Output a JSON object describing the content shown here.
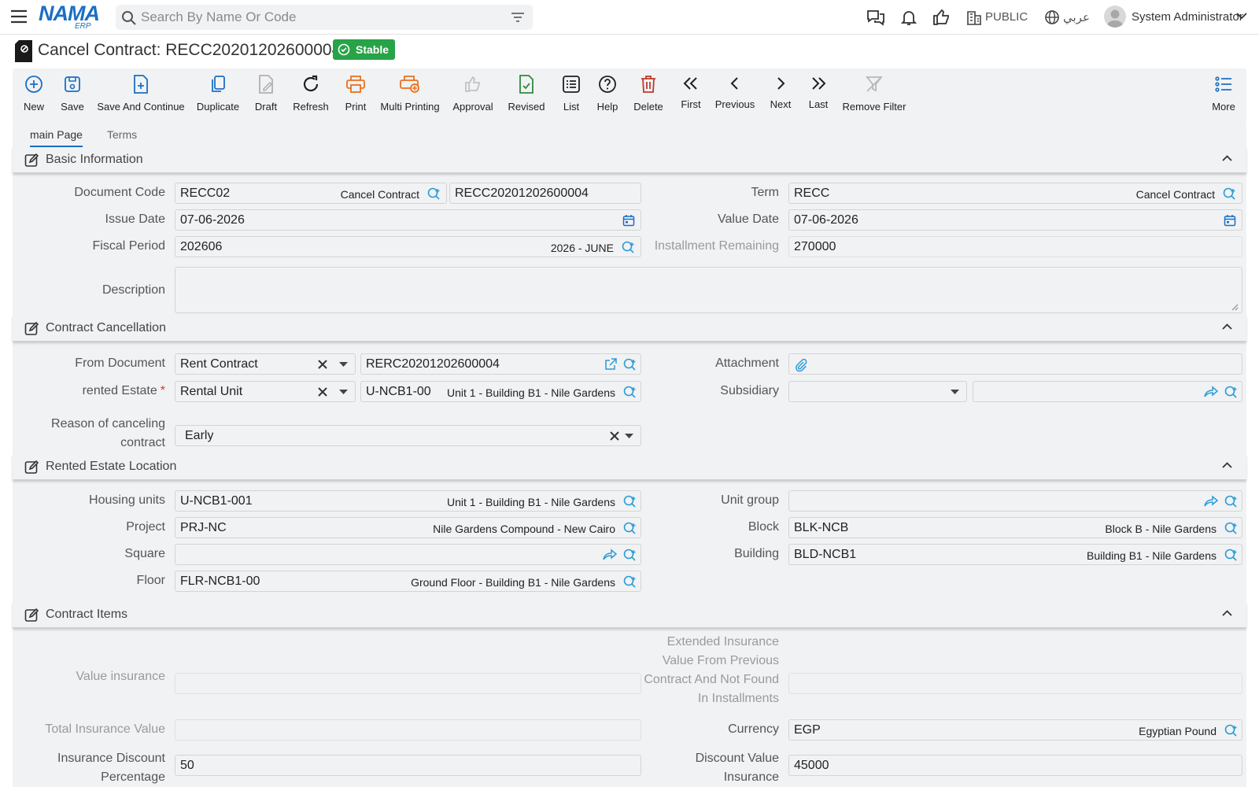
{
  "header": {
    "logo_main": "NAMA",
    "logo_sub": "ERP",
    "search_placeholder": "Search By Name Or Code",
    "branch": "PUBLIC",
    "language": "عربي",
    "user": "System Administrator"
  },
  "page": {
    "title": "Cancel Contract: RECC20201202600004",
    "status": "Stable"
  },
  "toolbar": {
    "new": "New",
    "save": "Save",
    "save_continue": "Save And Continue",
    "duplicate": "Duplicate",
    "draft": "Draft",
    "refresh": "Refresh",
    "print": "Print",
    "multi_printing": "Multi Printing",
    "approval": "Approval",
    "revised": "Revised",
    "list": "List",
    "help": "Help",
    "delete": "Delete",
    "first": "First",
    "previous": "Previous",
    "next": "Next",
    "last": "Last",
    "remove_filter": "Remove Filter",
    "more": "More"
  },
  "tabs": [
    "main Page",
    "Terms"
  ],
  "sections": {
    "basic": "Basic Information",
    "cancellation": "Contract Cancellation",
    "location": "Rented Estate Location",
    "items": "Contract Items"
  },
  "basic": {
    "document_code_label": "Document Code",
    "document_code": "RECC02",
    "document_code_desc": "Cancel Contract",
    "document_number": "RECC20201202600004",
    "term_label": "Term",
    "term": "RECC",
    "term_desc": "Cancel Contract",
    "issue_date_label": "Issue Date",
    "issue_date": "07-06-2026",
    "value_date_label": "Value Date",
    "value_date": "07-06-2026",
    "fiscal_period_label": "Fiscal Period",
    "fiscal_period": "202606",
    "fiscal_period_desc": "2026 - JUNE",
    "installment_remaining_label": "Installment Remaining",
    "installment_remaining": "270000",
    "description_label": "Description",
    "description": ""
  },
  "cancellation": {
    "from_document_label": "From Document",
    "from_document_type": "Rent Contract",
    "from_document_code": "RERC20201202600004",
    "attachment_label": "Attachment",
    "rented_estate_label": "rented Estate",
    "rented_estate_required": "*",
    "rented_estate_type": "Rental Unit",
    "rented_estate_code": "U-NCB1-00",
    "rented_estate_desc": "Unit 1 - Building B1 - Nile Gardens",
    "subsidiary_label": "Subsidiary",
    "subsidiary": "",
    "reason_label_1": "Reason of canceling",
    "reason_label_2": "contract",
    "reason": "Early"
  },
  "location": {
    "housing_units_label": "Housing units",
    "housing_units": "U-NCB1-001",
    "housing_units_desc": "Unit 1 - Building B1 - Nile Gardens",
    "unit_group_label": "Unit group",
    "unit_group": "",
    "project_label": "Project",
    "project": "PRJ-NC",
    "project_desc": "Nile Gardens Compound - New Cairo",
    "block_label": "Block",
    "block": "BLK-NCB",
    "block_desc": "Block B - Nile Gardens",
    "square_label": "Square",
    "square": "",
    "building_label": "Building",
    "building": "BLD-NCB1",
    "building_desc": "Building B1 - Nile Gardens",
    "floor_label": "Floor",
    "floor": "FLR-NCB1-00",
    "floor_desc": "Ground Floor - Building B1 - Nile Gardens"
  },
  "items": {
    "value_insurance_label": "Value insurance",
    "value_insurance": "",
    "extended_label_1": "Extended Insurance",
    "extended_label_2": "Value From Previous",
    "extended_label_3": "Contract And Not Found",
    "extended_label_4": "In Installments",
    "extended_value": "",
    "total_insurance_label": "Total Insurance Value",
    "total_insurance": "",
    "currency_label": "Currency",
    "currency": "EGP",
    "currency_desc": "Egyptian Pound",
    "insurance_discount_label_1": "Insurance Discount",
    "insurance_discount_label_2": "Percentage",
    "insurance_discount": "50",
    "discount_value_label_1": "Discount Value",
    "discount_value_label_2": "Insurance",
    "discount_value": "45000"
  },
  "colors": {
    "accent": "#1b6fc4",
    "stable": "#27a348",
    "print": "#e8701e",
    "delete": "#c0392b",
    "revised": "#2e8b3e",
    "lookup": "#2b9bd6"
  }
}
